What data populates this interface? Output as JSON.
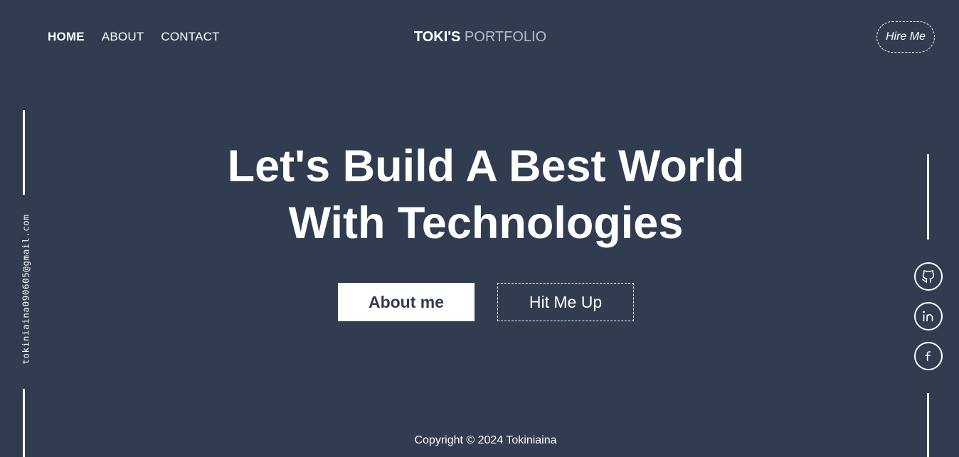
{
  "nav": {
    "items": [
      {
        "label": "HOME",
        "active": true
      },
      {
        "label": "ABOUT",
        "active": false
      },
      {
        "label": "CONTACT",
        "active": false
      }
    ]
  },
  "brand": {
    "strong": "TOKI'S",
    "light": "PORTFOLIO"
  },
  "header": {
    "hire_label": "Hire Me"
  },
  "sidebar": {
    "email": "tokiniaina090605@gmail.com"
  },
  "hero": {
    "line1": "Let's Build A Best World",
    "line2": "With Technologies",
    "primary_button": "About me",
    "secondary_button": "Hit Me Up"
  },
  "social": [
    {
      "icon": "github-icon"
    },
    {
      "icon": "linkedin-icon"
    },
    {
      "icon": "facebook-icon"
    }
  ],
  "footer": {
    "copyright": "Copyright © 2024 Tokiniaina"
  },
  "colors": {
    "background": "#313c51",
    "foreground": "#ffffff",
    "muted": "#b7bdc8"
  }
}
